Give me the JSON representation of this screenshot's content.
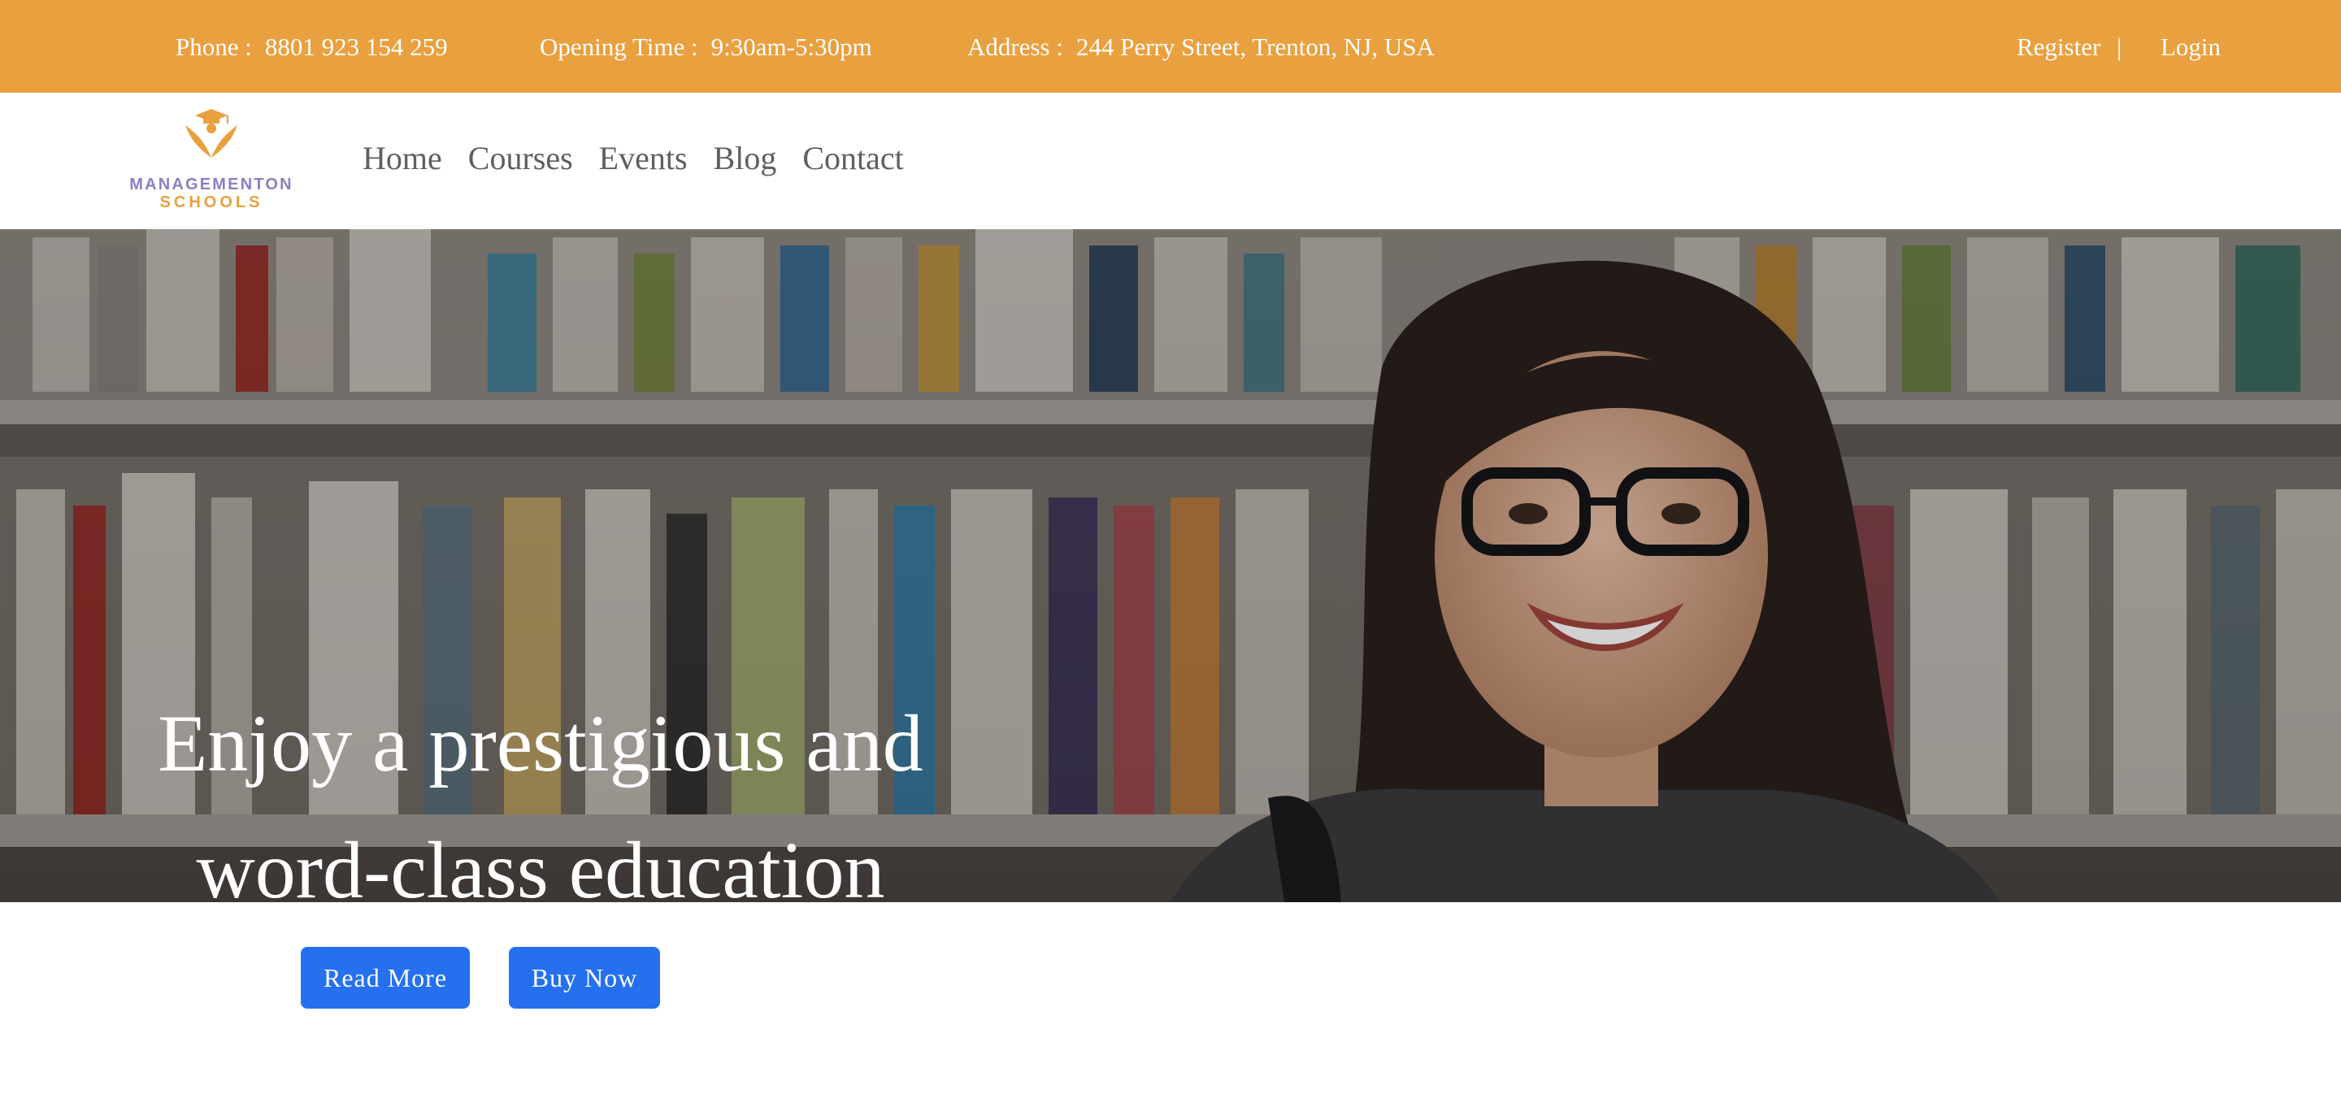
{
  "topbar": {
    "phone_label": "Phone :",
    "phone_value": "8801 923 154 259",
    "hours_label": "Opening Time :",
    "hours_value": "9:30am-5:30pm",
    "address_label": "Address :",
    "address_value": "244 Perry Street, Trenton, NJ, USA",
    "register": "Register",
    "separator": "|",
    "login": "Login"
  },
  "logo": {
    "line1": "MANAGEMENTON",
    "line2": "SCHOOLS"
  },
  "nav": {
    "items": [
      "Home",
      "Courses",
      "Events",
      "Blog",
      "Contact"
    ]
  },
  "hero": {
    "headline_line1": "Enjoy a prestigious and",
    "headline_line2": "word-class education",
    "image": "student-with-glasses-in-library"
  },
  "buttons": {
    "read_more": "Read More",
    "buy_now": "Buy Now"
  },
  "colors": {
    "topbar_bg": "#e9a03f",
    "button_bg": "#2570ee",
    "logo_purple": "#8a7fc4",
    "nav_text": "#5f5f5f"
  }
}
